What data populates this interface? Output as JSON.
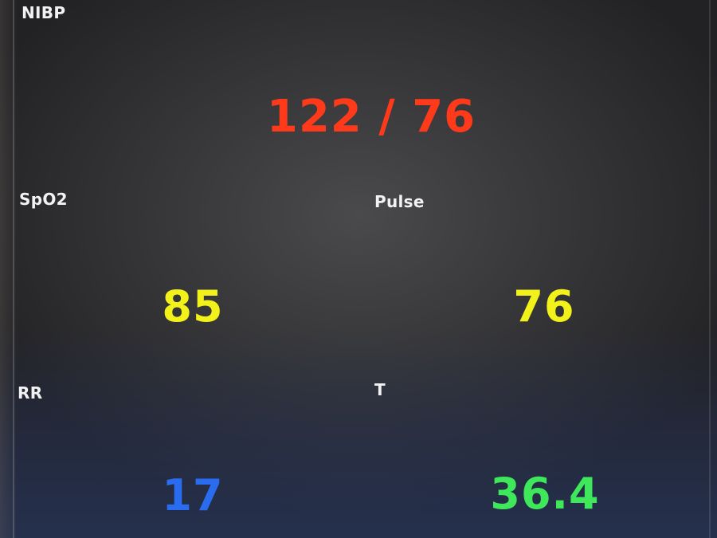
{
  "colors": {
    "nibp": "#ff3a1a",
    "spo2": "#f2f21a",
    "pulse": "#f2f21a",
    "rr": "#2a6cf0",
    "temperature": "#3ee85a"
  },
  "nibp": {
    "label": "NIBP",
    "value": "122 / 76"
  },
  "spo2": {
    "label": "SpO2",
    "value": "85"
  },
  "pulse": {
    "label": "Pulse",
    "value": "76"
  },
  "rr": {
    "label": "RR",
    "value": "17"
  },
  "temperature": {
    "label": "T",
    "value": "36.4"
  }
}
